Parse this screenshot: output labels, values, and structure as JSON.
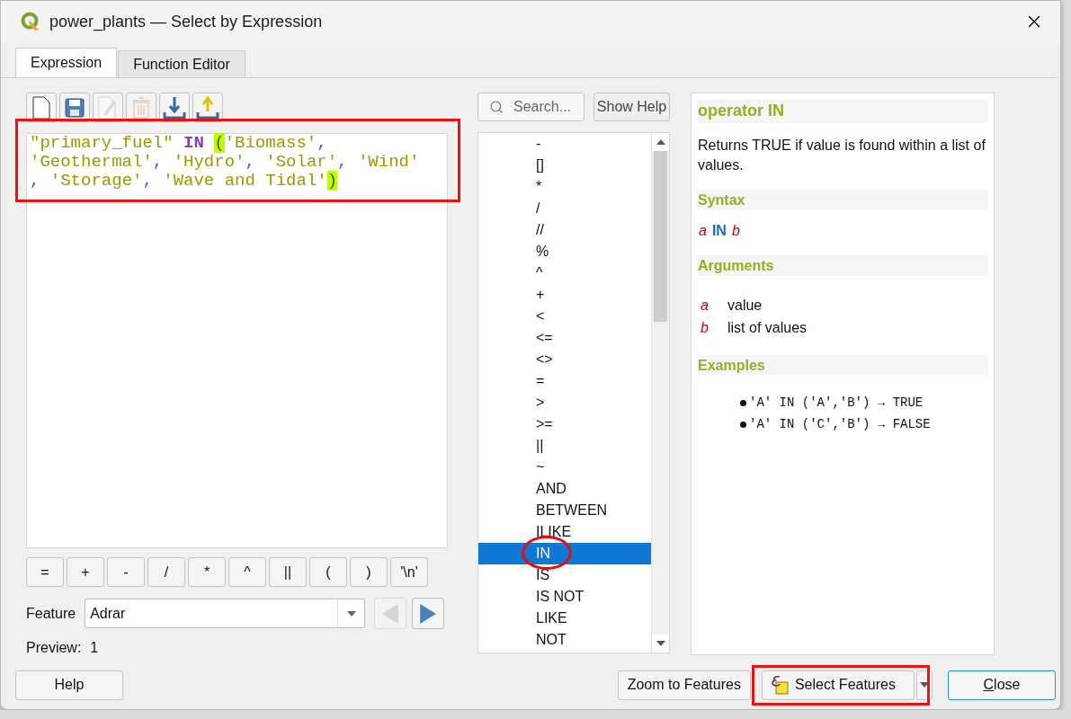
{
  "window": {
    "title": "power_plants — Select by Expression"
  },
  "tabs": [
    {
      "label": "Expression",
      "selected": true
    },
    {
      "label": "Function Editor",
      "selected": false
    }
  ],
  "toolbar": [
    {
      "kind": "new",
      "disabled": false
    },
    {
      "kind": "save",
      "disabled": false
    },
    {
      "kind": "edit",
      "disabled": true
    },
    {
      "kind": "delete",
      "disabled": true
    },
    {
      "kind": "import",
      "disabled": false
    },
    {
      "kind": "export",
      "disabled": false
    }
  ],
  "editor": {
    "marked": true,
    "lines": [
      [
        {
          "kind": "field",
          "text": "\"primary_fuel\" "
        },
        {
          "kind": "keyword",
          "text": "IN "
        },
        {
          "kind": "bracket",
          "text": "("
        },
        {
          "kind": "string",
          "text": "'Biomass'"
        },
        {
          "kind": "comma",
          "text": ","
        }
      ],
      [
        {
          "kind": "string",
          "text": "'Geothermal'"
        },
        {
          "kind": "comma",
          "text": ", "
        },
        {
          "kind": "string",
          "text": "'Hydro'"
        },
        {
          "kind": "comma",
          "text": ", "
        },
        {
          "kind": "string",
          "text": "'Solar'"
        },
        {
          "kind": "comma",
          "text": ", "
        },
        {
          "kind": "string",
          "text": "'Wind'"
        }
      ],
      [
        {
          "kind": "comma",
          "text": ", "
        },
        {
          "kind": "string",
          "text": "'Storage'"
        },
        {
          "kind": "comma",
          "text": ", "
        },
        {
          "kind": "string",
          "text": "'Wave and Tidal'"
        },
        {
          "kind": "bracket",
          "text": ")"
        }
      ]
    ]
  },
  "operators": [
    "=",
    "+",
    "-",
    "/",
    "*",
    "^",
    "||",
    "(",
    ")",
    "'\\n'"
  ],
  "feature": {
    "label": "Feature",
    "value": "Adrar",
    "prev_disabled": true,
    "next_disabled": false
  },
  "preview": {
    "label": "Preview:",
    "value": "1"
  },
  "search": {
    "placeholder": "Search..."
  },
  "show_help": "Show Help",
  "functions": [
    {
      "label": "-",
      "selected": false,
      "circled": false
    },
    {
      "label": "[]",
      "selected": false,
      "circled": false
    },
    {
      "label": "*",
      "selected": false,
      "circled": false
    },
    {
      "label": "/",
      "selected": false,
      "circled": false
    },
    {
      "label": "//",
      "selected": false,
      "circled": false
    },
    {
      "label": "%",
      "selected": false,
      "circled": false
    },
    {
      "label": "^",
      "selected": false,
      "circled": false
    },
    {
      "label": "+",
      "selected": false,
      "circled": false
    },
    {
      "label": "<",
      "selected": false,
      "circled": false
    },
    {
      "label": "<=",
      "selected": false,
      "circled": false
    },
    {
      "label": "<>",
      "selected": false,
      "circled": false
    },
    {
      "label": "=",
      "selected": false,
      "circled": false
    },
    {
      "label": ">",
      "selected": false,
      "circled": false
    },
    {
      "label": ">=",
      "selected": false,
      "circled": false
    },
    {
      "label": "||",
      "selected": false,
      "circled": false
    },
    {
      "label": "~",
      "selected": false,
      "circled": false
    },
    {
      "label": "AND",
      "selected": false,
      "circled": false
    },
    {
      "label": "BETWEEN",
      "selected": false,
      "circled": false
    },
    {
      "label": "ILIKE",
      "selected": false,
      "circled": false
    },
    {
      "label": "IN",
      "selected": true,
      "circled": true
    },
    {
      "label": "IS",
      "selected": false,
      "circled": false
    },
    {
      "label": "IS NOT",
      "selected": false,
      "circled": false
    },
    {
      "label": "LIKE",
      "selected": false,
      "circled": false
    },
    {
      "label": "NOT",
      "selected": false,
      "circled": false
    }
  ],
  "help": {
    "title": "operator IN",
    "description": "Returns TRUE if value is found within a list of values.",
    "syntax_heading": "Syntax",
    "syntax": [
      {
        "kind": "param",
        "text": "a"
      },
      {
        "kind": "keyword",
        "text": "IN"
      },
      {
        "kind": "param",
        "text": "b"
      }
    ],
    "arguments_heading": "Arguments",
    "arguments": [
      {
        "name": "a",
        "description": "value"
      },
      {
        "name": "b",
        "description": "list of values"
      }
    ],
    "examples_heading": "Examples",
    "examples": [
      "'A' IN ('A','B') → TRUE",
      "'A' IN ('C','B') → FALSE"
    ]
  },
  "footer": {
    "help_button": "Help",
    "zoom_button": "Zoom to Features",
    "select_button": {
      "label": "Select Features",
      "marked": true
    },
    "close_button": {
      "label": "Close",
      "underline_first": true
    }
  }
}
